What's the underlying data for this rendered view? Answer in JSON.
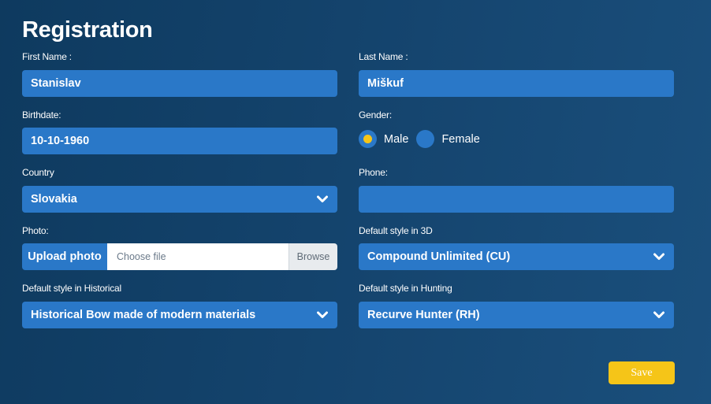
{
  "page": {
    "title": "Registration"
  },
  "form": {
    "first_name": {
      "label": "First Name :",
      "value": "Stanislav"
    },
    "last_name": {
      "label": "Last Name :",
      "value": "Miškuf"
    },
    "birthdate": {
      "label": "Birthdate:",
      "value": "10-10-1960"
    },
    "gender": {
      "label": "Gender:",
      "options": [
        {
          "label": "Male",
          "selected": true
        },
        {
          "label": "Female",
          "selected": false
        }
      ]
    },
    "country": {
      "label": "Country",
      "value": "Slovakia"
    },
    "phone": {
      "label": "Phone:",
      "value": ""
    },
    "photo": {
      "label": "Photo:",
      "upload_label": "Upload photo",
      "placeholder": "Choose file",
      "browse_label": "Browse"
    },
    "style_3d": {
      "label": "Default style in 3D",
      "value": "Compound Unlimited (CU)"
    },
    "style_historical": {
      "label": "Default style in Historical",
      "value": "Historical Bow made of modern materials"
    },
    "style_hunting": {
      "label": "Default style in Hunting",
      "value": "Recurve Hunter (RH)"
    },
    "save_label": "Save"
  },
  "colors": {
    "field_bg": "#2a78c8",
    "accent": "#f5c518",
    "background": "#15456f"
  },
  "icons": {
    "select_arrow": "chevron-down-icon"
  }
}
